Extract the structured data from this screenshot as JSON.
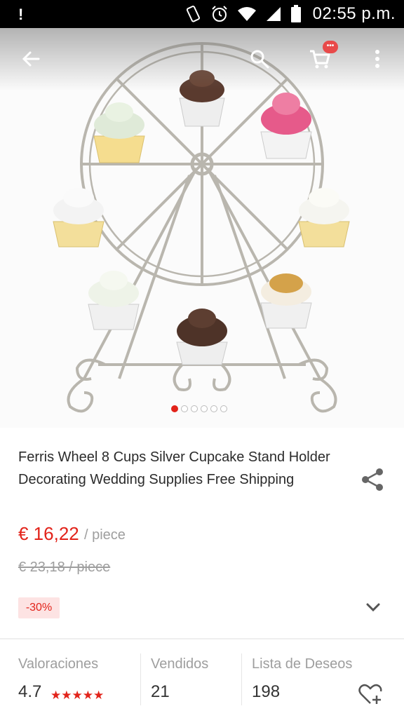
{
  "status_bar": {
    "notification": "!",
    "time": "02:55 p.m.",
    "icons": [
      "vibrate-icon",
      "alarm-icon",
      "wifi-icon",
      "signal-icon",
      "battery-icon"
    ]
  },
  "toolbar": {
    "cart_badge": "•••",
    "icons": [
      "back-arrow-icon",
      "search-icon",
      "cart-icon",
      "more-vert-icon"
    ]
  },
  "gallery": {
    "image_count": 6,
    "active_index": 0
  },
  "product": {
    "title": "Ferris Wheel 8 Cups Silver Cupcake Stand Holder Decorating Wedding Supplies Free Shipping",
    "price": "€ 16,22",
    "price_unit": "/ piece",
    "old_price": "€ 23,18 / piece",
    "discount": "-30%"
  },
  "stats": {
    "rating_label": "Valoraciones",
    "rating_value": "4.7",
    "rating_stars": "★★★★★",
    "sold_label": "Vendidos",
    "sold_value": "21",
    "wishlist_label": "Lista de Deseos",
    "wishlist_value": "198"
  },
  "colors": {
    "accent": "#e2231a",
    "discount_bg": "#fde3e3",
    "muted_text": "#9e9e9e"
  }
}
